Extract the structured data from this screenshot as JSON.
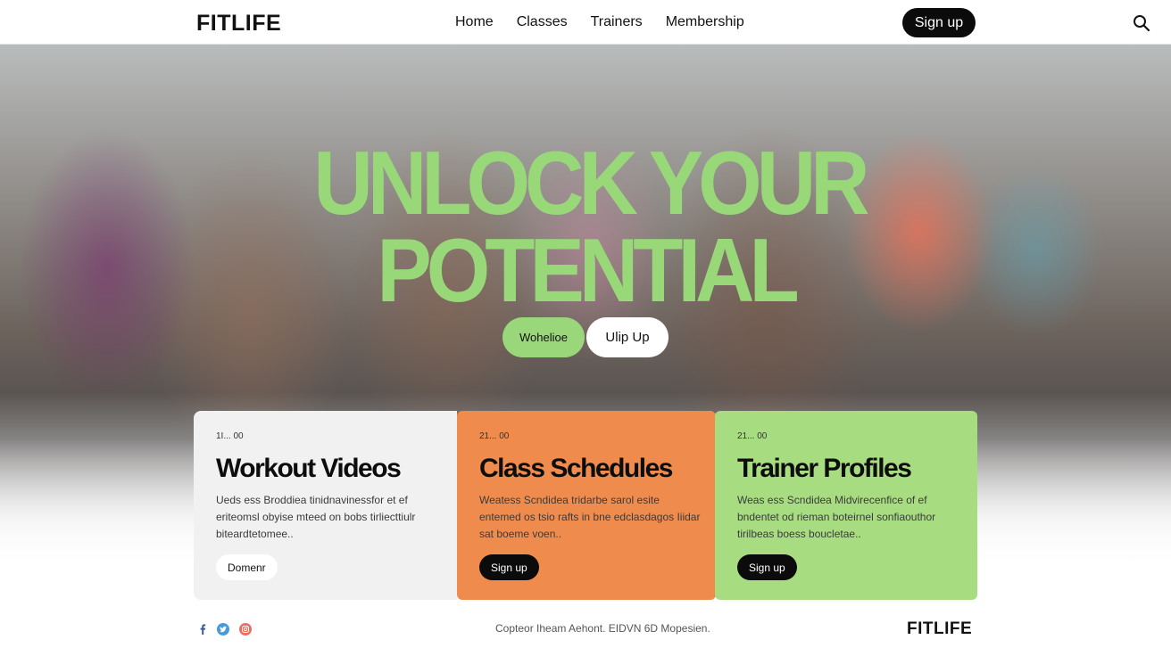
{
  "header": {
    "logo": "FITLIFE",
    "nav": [
      "Home",
      "Classes",
      "Trainers",
      "Membership"
    ],
    "signup_label": "Sign up",
    "search_icon": "search-icon"
  },
  "hero": {
    "headline_line1": "UNLOCK YOUR",
    "headline_line2": "POTENTIAL",
    "button_primary": "Wohelioe",
    "button_secondary": "Ulip Up",
    "accent_color": "#98d878"
  },
  "cards": [
    {
      "meta": "1I... 00",
      "title": "Workout Videos",
      "text": "Ueds ess Broddiea tinidnavinessfor et ef eriteomsl obyise mteed on bobs tirliecttiulr biteardtetomee..",
      "button": "Domenr",
      "color": "#f1f1f1"
    },
    {
      "meta": "21... 00",
      "title": "Class Schedules",
      "text": "Weatess Scndidea tridarbe sarol esite entemed os tsio rafts in bne edclasdagos Iiidar sat boeme voen..",
      "button": "Sign up",
      "color": "#ef8c4d"
    },
    {
      "meta": "21... 00",
      "title": "Trainer Profiles",
      "text": "Weas ess Scndidea Midvirecenfice of ef bndentet od rieman boteirnel sonfiaouthor tirilbeas boess boucletae..",
      "button": "Sign up",
      "color": "#a7dc80"
    }
  ],
  "footer": {
    "social_icons": [
      "facebook-icon",
      "twitter-icon",
      "instagram-icon"
    ],
    "copyright": "Copteor Iheam Aehont. EIDVN 6D Mopesien.",
    "logo": "FITLIFE"
  }
}
